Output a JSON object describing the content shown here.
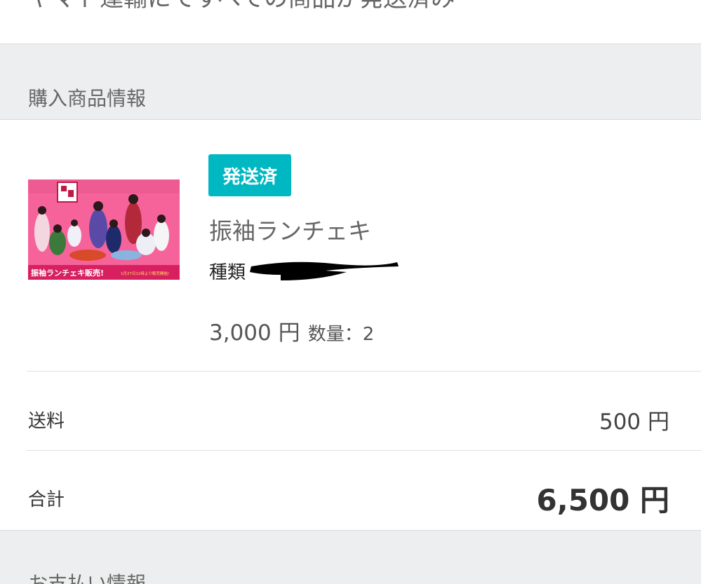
{
  "top_status": {
    "text": "ヤマト運輸にてすべての商品が発送済み"
  },
  "purchase_section": {
    "title": "購入商品情報"
  },
  "item": {
    "image_caption": "振袖ランチェキ販売!",
    "image_subcaption": "1月27日12時より販売開始!",
    "status_badge": "発送済",
    "name": "振袖ランチェキ",
    "variant_label": "種類",
    "unit_price": "3,000 円",
    "quantity_text": "数量：2"
  },
  "summary": {
    "shipping_label": "送料",
    "shipping_value": "500 円",
    "total_label": "合計",
    "total_value": "6,500 円"
  },
  "payment_section": {
    "title": "お支払い情報"
  },
  "colors": {
    "badge": "#00b8c2",
    "section_bg": "#eceeef",
    "image_bg": "#f06090"
  }
}
